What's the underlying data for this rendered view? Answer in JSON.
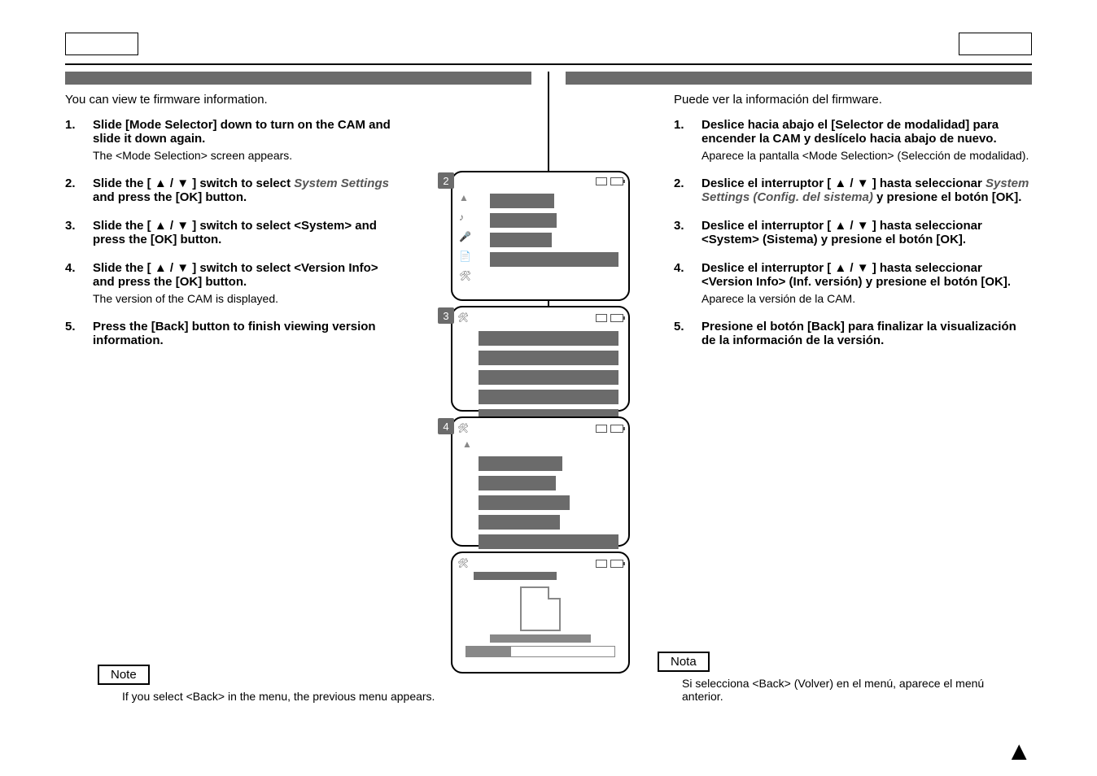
{
  "left": {
    "intro": "You can view te firmware information.",
    "steps": [
      {
        "num": "1.",
        "bold": "Slide [Mode Selector] down to turn on the CAM and slide it down again.",
        "sub": "The <Mode Selection> screen appears."
      },
      {
        "num": "2.",
        "bold_pre": "Slide the [ ▲ / ▼ ] switch to select ",
        "italic": "System Settings",
        "bold_post": " and press the [OK] button."
      },
      {
        "num": "3.",
        "bold": "Slide the [ ▲ / ▼ ] switch to select <System> and press the [OK] button."
      },
      {
        "num": "4.",
        "bold": "Slide the [ ▲ / ▼ ] switch to select <Version Info> and press the [OK] button.",
        "sub": "The version of the CAM is displayed."
      },
      {
        "num": "5.",
        "bold": "Press the [Back] button to finish viewing version information."
      }
    ],
    "note_label": "Note",
    "note_text": "If you select <Back> in the menu, the previous menu appears."
  },
  "right": {
    "intro": "Puede ver la información del firmware.",
    "steps": [
      {
        "num": "1.",
        "bold": "Deslice hacia abajo el [Selector de modalidad] para encender la CAM y deslícelo hacia abajo de nuevo.",
        "sub": "Aparece la pantalla <Mode Selection> (Selección de modalidad)."
      },
      {
        "num": "2.",
        "bold_pre": "Deslice el interruptor [ ▲ / ▼ ] hasta seleccionar ",
        "italic": "System Settings (Config. del sistema)",
        "bold_post": " y presione el botón [OK]."
      },
      {
        "num": "3.",
        "bold": "Deslice el interruptor [ ▲ / ▼ ] hasta seleccionar <System> (Sistema)  y presione el botón [OK]."
      },
      {
        "num": "4.",
        "bold": "Deslice el interruptor [ ▲ / ▼ ] hasta seleccionar <Version Info> (Inf. versión) y presione el botón [OK].",
        "sub": "Aparece la versión de la CAM."
      },
      {
        "num": "5.",
        "bold": "Presione el botón [Back] para finalizar la visualización de la información de la versión."
      }
    ],
    "note_label": "Nota",
    "note_text": "Si selecciona <Back> (Volver) en el menú, aparece el menú anterior."
  },
  "screens": {
    "badges": [
      "2",
      "3",
      "4"
    ]
  }
}
